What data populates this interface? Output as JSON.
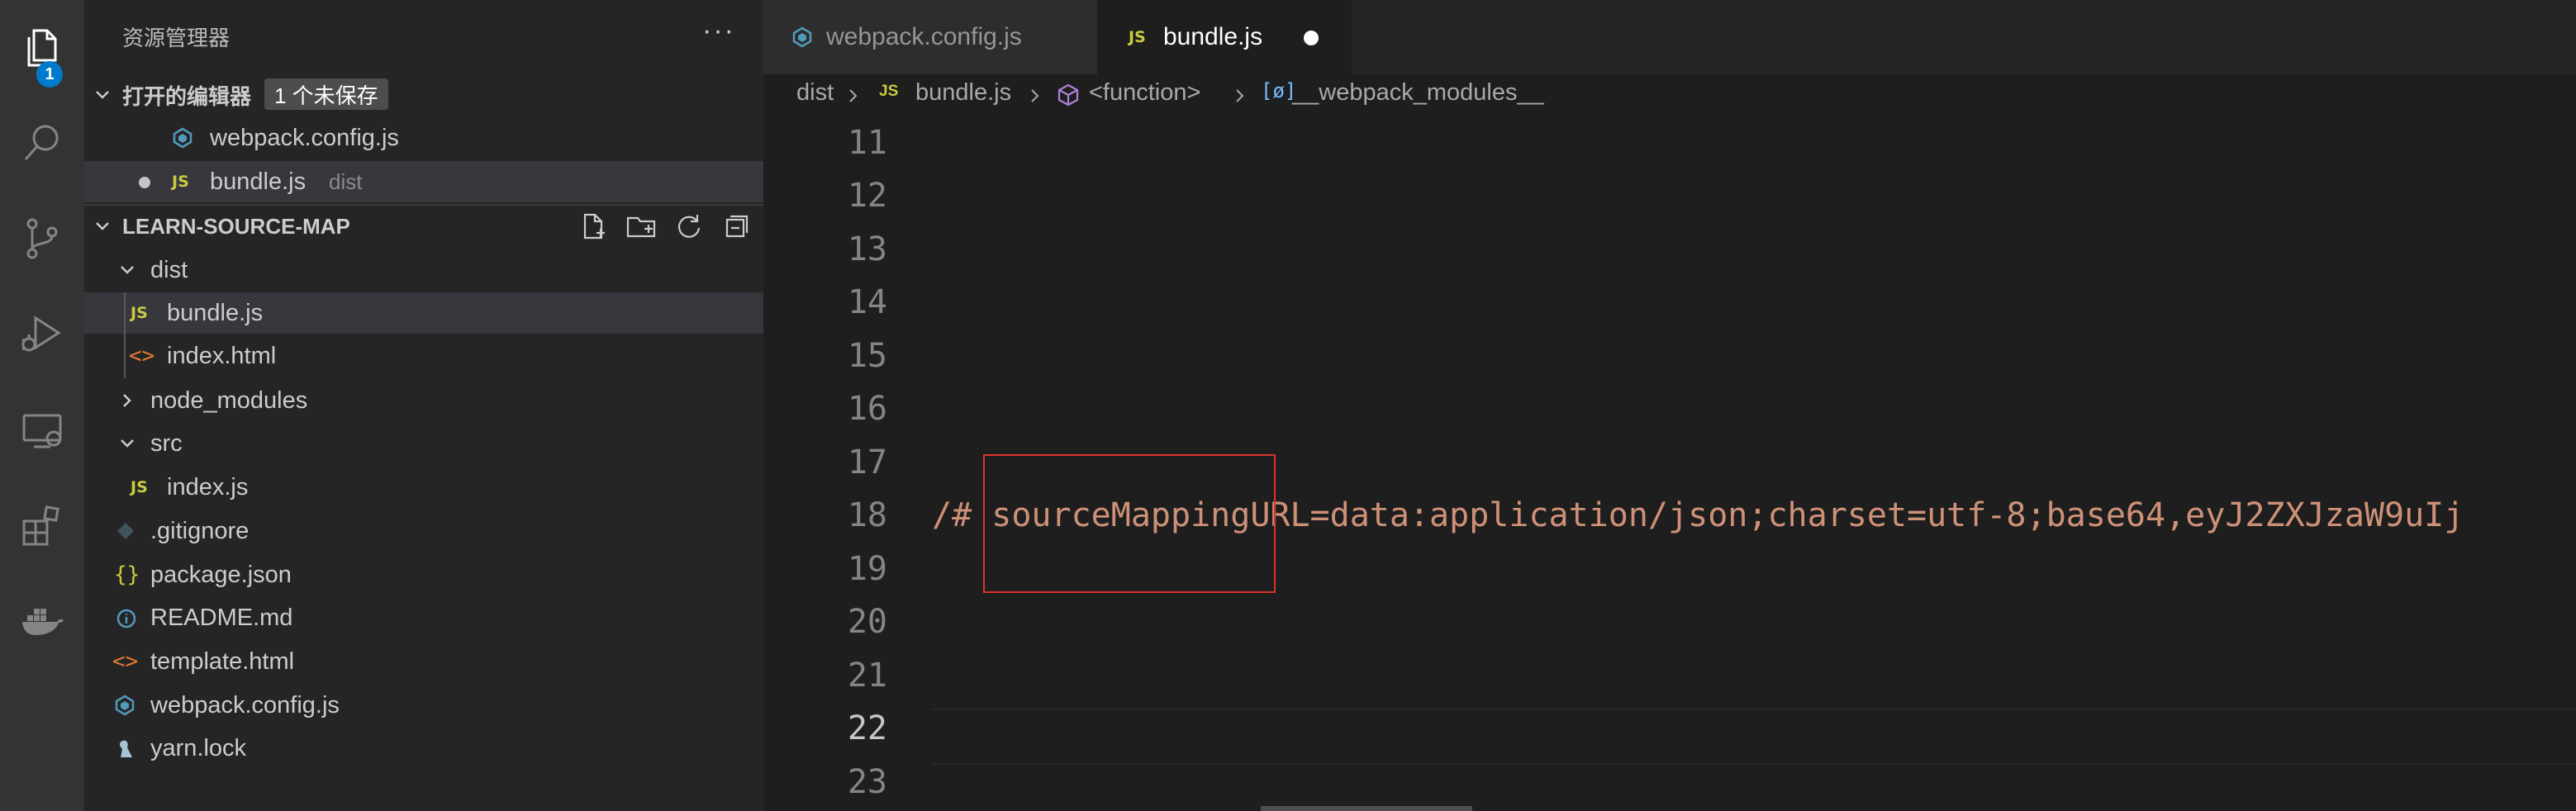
{
  "activity_bar": {
    "explorer_badge": "1",
    "items": [
      "files-icon",
      "search-icon",
      "source-control-icon",
      "run-debug-icon",
      "remote-explorer-icon",
      "extensions-icon",
      "docker-icon"
    ]
  },
  "sidebar": {
    "title": "资源管理器",
    "more": "···",
    "open_editors": {
      "label": "打开的编辑器",
      "unsaved_badge": "1 个未保存",
      "items": [
        {
          "name": "webpack.config.js",
          "desc": ""
        },
        {
          "name": "bundle.js",
          "desc": "dist"
        }
      ]
    },
    "project": {
      "label": "LEARN-SOURCE-MAP",
      "tree": [
        {
          "name": "dist"
        },
        {
          "name": "bundle.js"
        },
        {
          "name": "index.html"
        },
        {
          "name": "node_modules"
        },
        {
          "name": "src"
        },
        {
          "name": "index.js"
        },
        {
          "name": ".gitignore"
        },
        {
          "name": "package.json"
        },
        {
          "name": "README.md"
        },
        {
          "name": "template.html"
        },
        {
          "name": "webpack.config.js"
        },
        {
          "name": "yarn.lock"
        }
      ]
    }
  },
  "tabs": [
    {
      "label": "webpack.config.js",
      "icon": "JS"
    },
    {
      "label": "bundle.js",
      "icon": "JS"
    }
  ],
  "breadcrumb": {
    "parts": [
      "dist",
      "bundle.js",
      "<function>",
      "__webpack_modules__"
    ],
    "js_icon": "JS"
  },
  "editor": {
    "line_numbers": [
      "11",
      "12",
      "13",
      "14",
      "15",
      "16",
      "17",
      "18",
      "19",
      "20",
      "21",
      "22",
      "23"
    ],
    "current_line": "22",
    "code_line_18": "/# sourceMappingURL=data:application/json;charset=utf-8;base64,eyJ2ZXJzaW9uIj"
  },
  "colors": {
    "accent": "#007acc",
    "highlight_box": "#d9342b",
    "string": "#ce9178"
  }
}
